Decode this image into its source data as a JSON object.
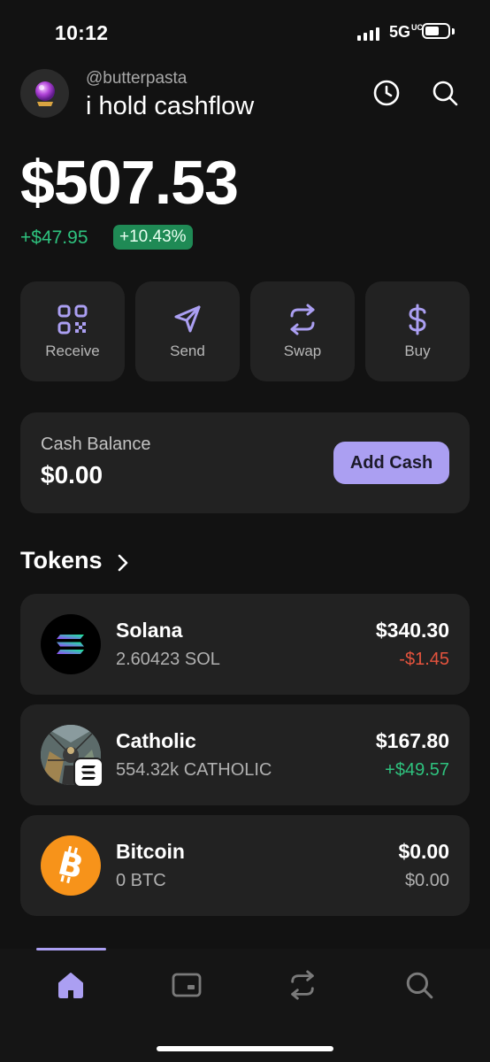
{
  "status_bar": {
    "time": "10:12",
    "network": "5G",
    "network_sup": "UC"
  },
  "header": {
    "handle": "@butterpasta",
    "wallet_name": "i hold cashflow",
    "icons": [
      "clock-icon",
      "search-icon"
    ]
  },
  "portfolio": {
    "balance": "$507.53",
    "change": "+$47.95",
    "change_pct": "+10.43%"
  },
  "actions": [
    {
      "label": "Receive",
      "icon": "qr-code-icon"
    },
    {
      "label": "Send",
      "icon": "send-icon"
    },
    {
      "label": "Swap",
      "icon": "swap-icon"
    },
    {
      "label": "Buy",
      "icon": "dollar-icon"
    }
  ],
  "cash": {
    "label": "Cash Balance",
    "value": "$0.00",
    "button": "Add Cash"
  },
  "tokens": {
    "title": "Tokens",
    "items": [
      {
        "name": "Solana",
        "amount": "2.60423 SOL",
        "usd": "$340.30",
        "change": "-$1.45",
        "change_color": "#e5533d"
      },
      {
        "name": "Catholic",
        "amount": "554.32k CATHOLIC",
        "usd": "$167.80",
        "change": "+$49.57",
        "change_color": "#2ec27e"
      },
      {
        "name": "Bitcoin",
        "amount": "0 BTC",
        "usd": "$0.00",
        "change": "$0.00",
        "change_color": "#b0b0b0"
      }
    ]
  },
  "nav": {
    "items": [
      "home-icon",
      "wallet-card-icon",
      "swap-icon",
      "search-icon"
    ],
    "active": "home-icon"
  },
  "colors": {
    "accent": "#ab9ff2",
    "positive": "#2ec27e",
    "negative": "#e5533d",
    "card": "#222222",
    "background": "#121212"
  }
}
